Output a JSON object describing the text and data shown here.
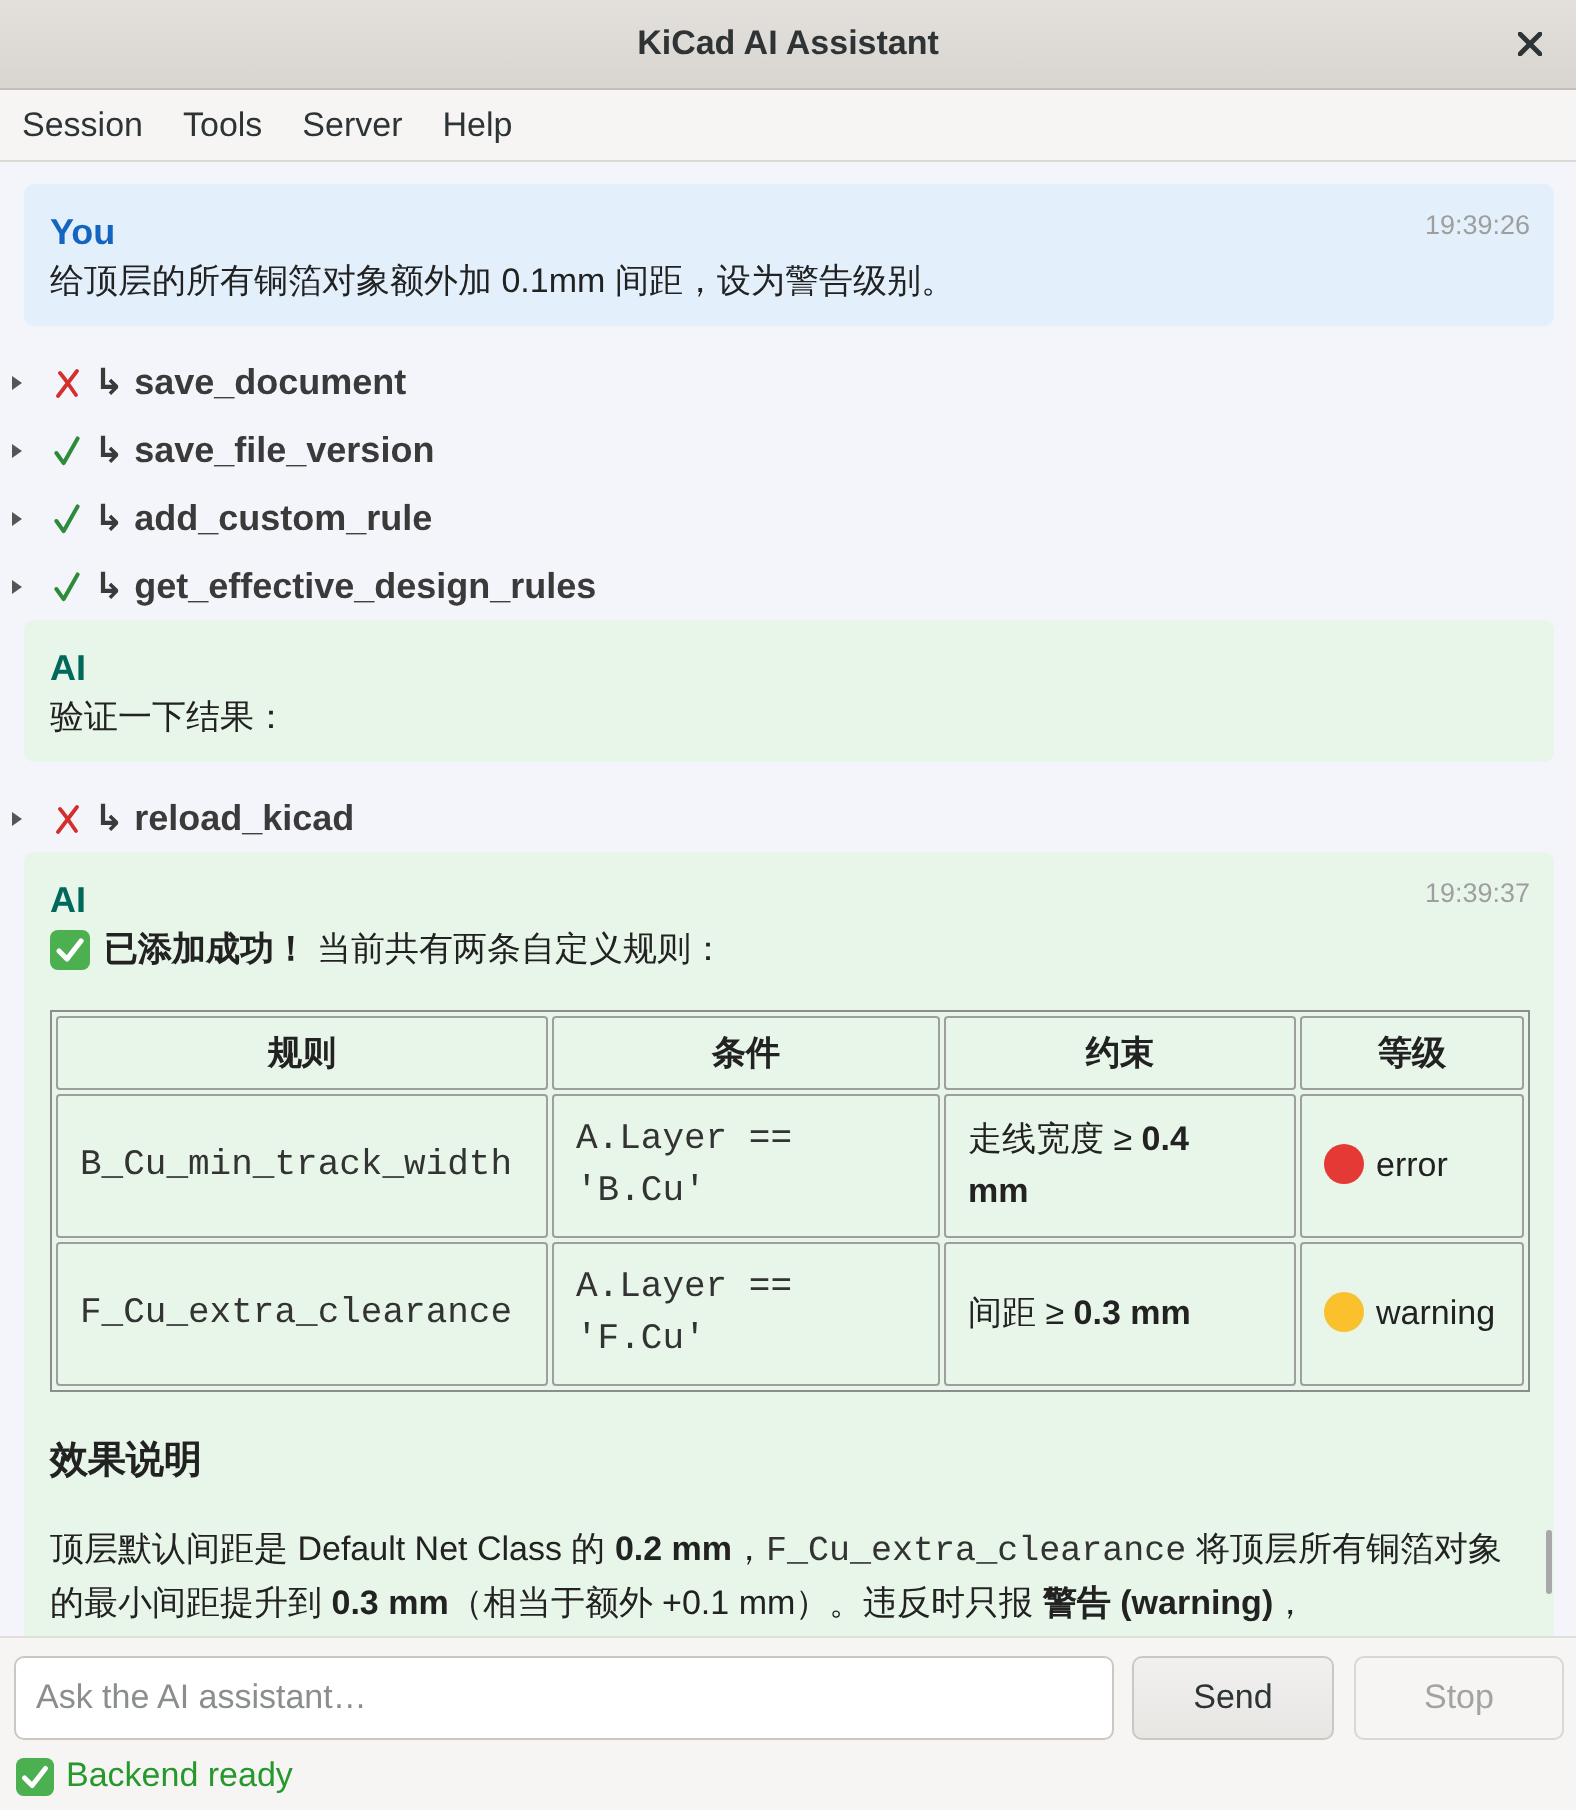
{
  "window": {
    "title": "KiCad AI Assistant"
  },
  "menu": [
    "Session",
    "Tools",
    "Server",
    "Help"
  ],
  "transcript": [
    {
      "kind": "user_message",
      "sender": "You",
      "time": "19:39:26",
      "blocks": [
        {
          "kind": "text",
          "text": "给顶层的所有铜箔对象额外加 0.1mm 间距，设为警告级别。"
        }
      ]
    },
    {
      "kind": "tool_call",
      "name": "↳ save_document",
      "ok": false,
      "expanded": false
    },
    {
      "kind": "tool_call",
      "name": "↳ save_file_version",
      "ok": true,
      "expanded": false
    },
    {
      "kind": "tool_call",
      "name": "↳ add_custom_rule",
      "ok": true,
      "expanded": false
    },
    {
      "kind": "tool_call",
      "name": "↳ get_effective_design_rules",
      "ok": true,
      "expanded": false
    },
    {
      "kind": "ai_message",
      "sender": "AI",
      "blocks": [
        {
          "kind": "text",
          "text": "验证一下结果："
        }
      ]
    },
    {
      "kind": "tool_call",
      "name": "↳ reload_kicad",
      "ok": false,
      "expanded": false
    },
    {
      "kind": "ai_message",
      "sender": "AI",
      "time": "19:39:37",
      "blocks": [
        {
          "kind": "success",
          "text": "**已添加成功！** 当前共有两条自定义规则："
        },
        {
          "kind": "table",
          "columns": [
            {
              "label": "规则",
              "kind": "code"
            },
            {
              "label": "条件",
              "kind": "code"
            },
            {
              "label": "约束",
              "kind": "text"
            },
            {
              "label": "等级",
              "kind": "severity"
            }
          ],
          "rows": [
            {
              "cells": [
                "B_Cu_min_track_width",
                "A.Layer == 'B.Cu'",
                "走线宽度 ≥ **0.4 mm**",
                "error"
              ],
              "color": "#e53935"
            },
            {
              "cells": [
                "F_Cu_extra_clearance",
                "A.Layer == 'F.Cu'",
                "间距 ≥ **0.3 mm**",
                "warning"
              ],
              "color": "#fbc02d"
            }
          ]
        },
        {
          "kind": "heading",
          "text": "效果说明"
        },
        {
          "kind": "paragraph",
          "segments": [
            {
              "kind": "text",
              "text": "顶层默认间距是 Default Net Class 的 **0.2 mm**，"
            },
            {
              "kind": "code",
              "text": "F_Cu_extra_clearance"
            },
            {
              "kind": "text",
              "text": " 将顶层所有铜箔对象的最小间距提升到 **0.3 mm**（相当于额外 +0.1 mm）。违反时只报 **警告 (warning)**，"
            }
          ]
        }
      ]
    }
  ],
  "input": {
    "placeholder": "Ask the AI assistant…"
  },
  "send_button": {
    "label": "Send",
    "disabled": false
  },
  "stop_button": {
    "label": "Stop",
    "disabled": true
  },
  "status_bar": {
    "ok": true,
    "text": "Backend ready"
  }
}
